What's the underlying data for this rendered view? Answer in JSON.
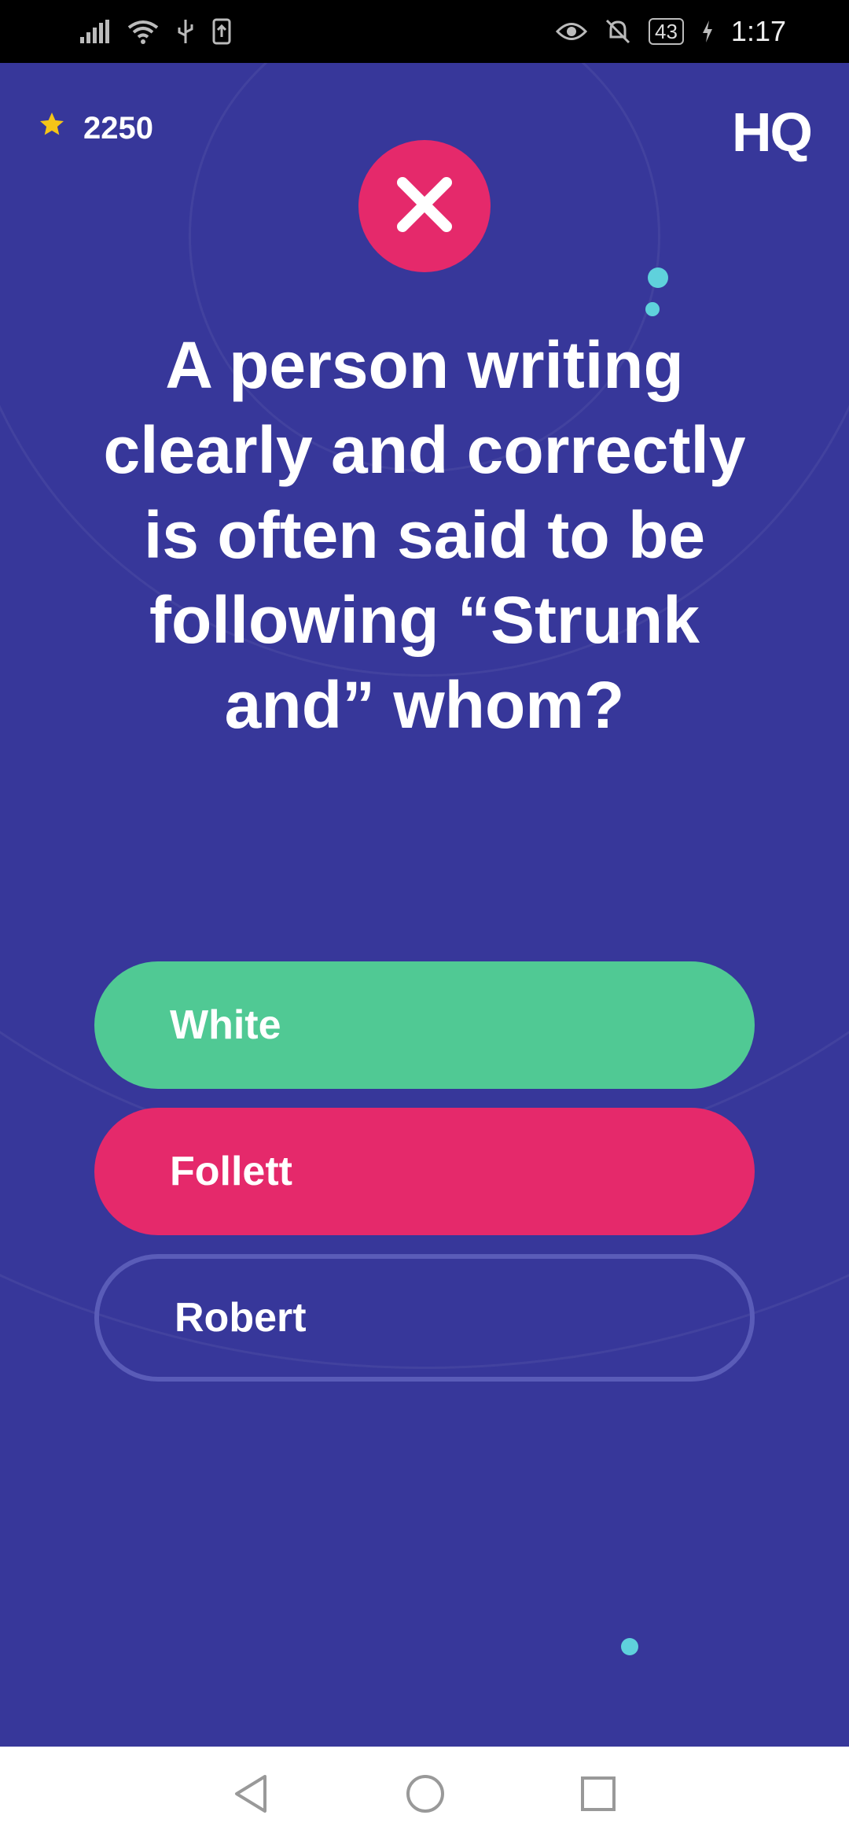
{
  "status_bar": {
    "battery": "43",
    "time": "1:17"
  },
  "game": {
    "score": "2250",
    "logo": "HQ",
    "result_icon": "close-icon",
    "question": "A person writing clearly and correctly is often said to be following “Strunk and” whom?",
    "answers": [
      {
        "label": "White",
        "state": "correct"
      },
      {
        "label": "Follett",
        "state": "selected-wrong"
      },
      {
        "label": "Robert",
        "state": "neutral"
      }
    ]
  },
  "colors": {
    "background": "#37379a",
    "correct": "#50c994",
    "wrong": "#e5296b",
    "accent_dot": "#5fd1dc",
    "star": "#f5c518"
  },
  "nav_bar": {
    "icons": [
      "back-icon",
      "home-icon",
      "recents-icon"
    ]
  }
}
